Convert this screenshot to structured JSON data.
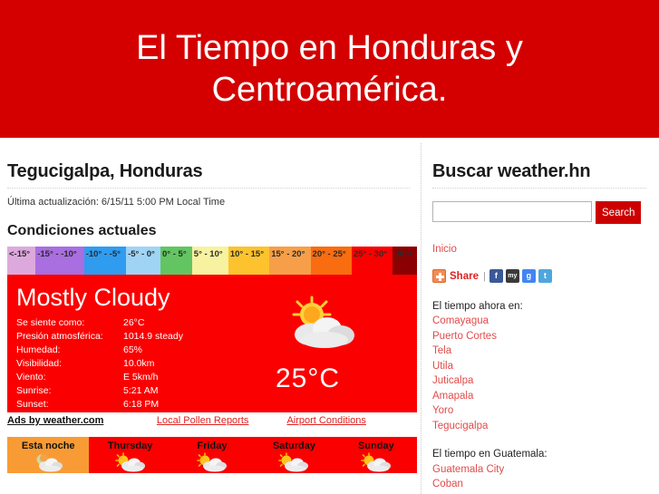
{
  "header": {
    "title": "El Tiempo en Honduras y Centroamérica.",
    "bg_color": "#d40000"
  },
  "main": {
    "location_heading": "Tegucigalpa, Honduras",
    "updated_text": "Última actualización: 6/15/11 5:00 PM Local Time",
    "conditions_heading": "Condiciones actuales",
    "temp_legend": [
      {
        "label": "<-15°",
        "color": "#dda9dd"
      },
      {
        "label": "-15° - -10°",
        "color": "#a96ee0"
      },
      {
        "label": "-10° - -5°",
        "color": "#2f9cf0"
      },
      {
        "label": "-5° - 0°",
        "color": "#9fd4f5"
      },
      {
        "label": "0° - 5°",
        "color": "#62c562"
      },
      {
        "label": "5° - 10°",
        "color": "#f7f2a0"
      },
      {
        "label": "10° - 15°",
        "color": "#fcc32e"
      },
      {
        "label": "15° - 20°",
        "color": "#f79f48"
      },
      {
        "label": "20° - 25°",
        "color": "#f96d10"
      },
      {
        "label": "25° - 30°",
        "color": "#fb0000"
      },
      {
        "label": "30°+",
        "color": "#8b0000"
      }
    ],
    "current": {
      "condition": "Mostly Cloudy",
      "temperature": "25°C",
      "icon": "sun-behind-cloud-icon",
      "panel_color": "#fb0000",
      "rows": [
        {
          "label": "Se siente como:",
          "value": "26°C"
        },
        {
          "label": "Presión atmosférica:",
          "value": "1014.9 steady"
        },
        {
          "label": "Humedad:",
          "value": "65%"
        },
        {
          "label": "Visibilidad:",
          "value": "10.0km"
        },
        {
          "label": "Viento:",
          "value": "E 5km/h"
        },
        {
          "label": "Sunrise:",
          "value": "5:21 AM"
        },
        {
          "label": "Sunset:",
          "value": "6:18 PM"
        }
      ]
    },
    "ads_row": {
      "ads_label": "Ads by weather.com",
      "pollen_link": "Local Pollen Reports",
      "airport_link": "Airport Conditions"
    },
    "forecast": [
      {
        "day": "Esta noche",
        "icon": "night-cloud-icon",
        "highlight": true
      },
      {
        "day": "Thursday",
        "icon": "sun-behind-cloud-icon",
        "highlight": false
      },
      {
        "day": "Friday",
        "icon": "sun-behind-cloud-icon",
        "highlight": false
      },
      {
        "day": "Saturday",
        "icon": "sun-behind-cloud-icon",
        "highlight": false
      },
      {
        "day": "Sunday",
        "icon": "sun-behind-cloud-icon",
        "highlight": false
      }
    ]
  },
  "sidebar": {
    "search_heading": "Buscar weather.hn",
    "search_value": "",
    "search_placeholder": "",
    "search_button": "Search",
    "home_link": "Inicio",
    "share": {
      "label": "Share",
      "separator": "|",
      "icons": [
        "facebook-icon",
        "myspace-icon",
        "google-icon",
        "twitter-icon"
      ],
      "facebook_glyph": "f",
      "myspace_glyph": "my",
      "google_glyph": "g",
      "twitter_glyph": "t"
    },
    "now_label": "El tiempo ahora en:",
    "now_cities": [
      "Comayagua",
      "Puerto Cortes",
      "Tela",
      "Utila",
      "Juticalpa",
      "Amapala",
      "Yoro",
      "Tegucigalpa"
    ],
    "guatemala_label": "El tiempo en Guatemala:",
    "guatemala_cities": [
      "Guatemala City",
      "Coban"
    ]
  }
}
